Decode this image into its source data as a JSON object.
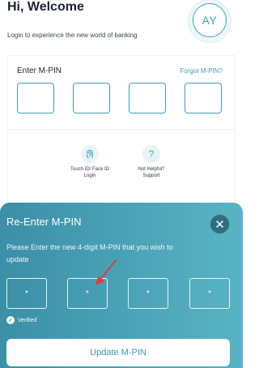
{
  "header": {
    "greeting": "Hi, Welcome",
    "subtitle": "Login to experience the new world of banking",
    "avatar_initials": "AY"
  },
  "login_card": {
    "mpin_label": "Enter M-PIN",
    "forgot_label": "Forgot M-PIN?",
    "options": [
      {
        "label_line1": "Touch ID/ Face ID",
        "label_line2": "Login",
        "icon": "fingerprint-icon"
      },
      {
        "label_line1": "Not Helpful?",
        "label_line2": "Support",
        "icon": "question-icon",
        "glyph": "?"
      }
    ]
  },
  "sheet": {
    "title": "Re-Enter M-PIN",
    "description": "Please Enter the new 4-digit M-PIN that you wish to update",
    "pin_mask": [
      "*",
      "*",
      "*",
      "*"
    ],
    "verified_label": "Verified",
    "update_button": "Update M-PIN",
    "close_glyph": "✕"
  },
  "colors": {
    "accent": "#3da1b2",
    "sheet_gradient_start": "#3b8fa7",
    "sheet_gradient_end": "#58b4c4",
    "annotation_arrow": "#e53935"
  }
}
